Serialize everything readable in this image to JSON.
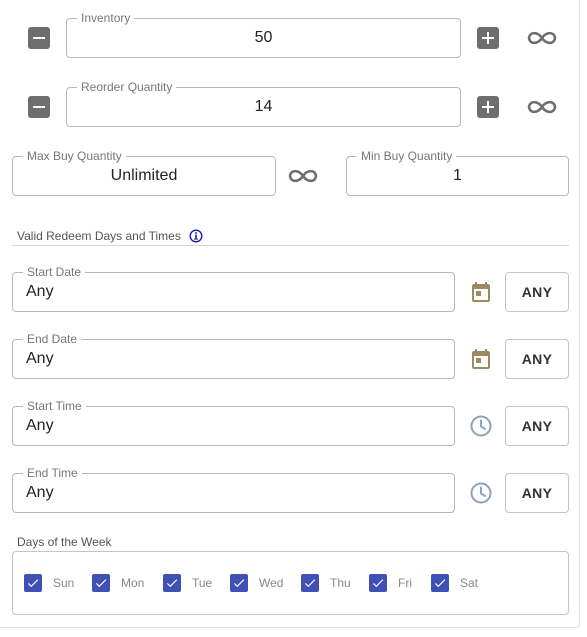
{
  "inventory": {
    "label": "Inventory",
    "value": "50"
  },
  "reorder": {
    "label": "Reorder Quantity",
    "value": "14"
  },
  "max_buy": {
    "label": "Max Buy Quantity",
    "value": "Unlimited"
  },
  "min_buy": {
    "label": "Min Buy Quantity",
    "value": "1"
  },
  "redeem": {
    "title": "Valid Redeem Days and Times",
    "start_date": {
      "label": "Start Date",
      "value": "Any",
      "any_label": "ANY"
    },
    "end_date": {
      "label": "End Date",
      "value": "Any",
      "any_label": "ANY"
    },
    "start_time": {
      "label": "Start Time",
      "value": "Any",
      "any_label": "ANY"
    },
    "end_time": {
      "label": "End Time",
      "value": "Any",
      "any_label": "ANY"
    }
  },
  "days": {
    "title": "Days of the Week",
    "items": [
      {
        "label": "Sun",
        "checked": true
      },
      {
        "label": "Mon",
        "checked": true
      },
      {
        "label": "Tue",
        "checked": true
      },
      {
        "label": "Wed",
        "checked": true
      },
      {
        "label": "Thu",
        "checked": true
      },
      {
        "label": "Fri",
        "checked": true
      },
      {
        "label": "Sat",
        "checked": true
      }
    ]
  },
  "icons": {
    "minus": "minus-icon",
    "plus": "plus-icon",
    "infinity": "infinity-icon",
    "calendar": "calendar-icon",
    "clock": "clock-icon",
    "info": "info-icon",
    "check": "checkmark-icon"
  },
  "colors": {
    "checkbox": "#3f51b5",
    "calendar_icon": "#9c8a63",
    "clock_icon": "#8ea2bb",
    "info_icon": "#1a1ab5",
    "stepper_button": "#6e6e6e"
  }
}
